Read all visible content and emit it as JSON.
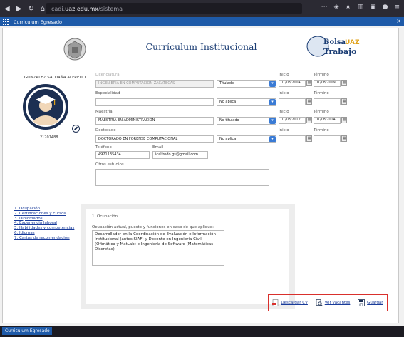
{
  "browser": {
    "url_prefix": "cadi.",
    "url_host": "uaz.edu.mx",
    "url_path": "/sistema"
  },
  "app": {
    "title": "Curriculum Egresado",
    "close": "×",
    "taskbar_tab": "Curriculum Egresado"
  },
  "page": {
    "title": "Currículum Institucional"
  },
  "profile": {
    "name": "GONZALEZ SALDAÑA ALFREDO",
    "code": "21201488"
  },
  "labels": {
    "licenciatura": "Licenciatura",
    "especialidad": "Especialidad",
    "maestria": "Maestría",
    "doctorado": "Doctorado",
    "telefono": "Teléfono",
    "email": "Email",
    "otros": "Otros estudios",
    "inicio": "Inicio",
    "termino": "Término"
  },
  "studies": {
    "licenciatura": {
      "value": "INGENIERIA EN COMPUTACION ZACATECAS",
      "status": "Titulado",
      "inicio": "01/08/2004",
      "termino": "01/08/2009"
    },
    "especialidad": {
      "value": "",
      "status": "No aplica",
      "inicio": "",
      "termino": ""
    },
    "maestria": {
      "value": "MAESTRIA EN ADMINISTRACION",
      "status": "No titulado",
      "inicio": "01/08/2012",
      "termino": "01/08/2014"
    },
    "doctorado": {
      "value": "DOCTORADO EN FORENSE COMPUTACIONAL",
      "status": "No aplica",
      "inicio": "",
      "termino": ""
    }
  },
  "contact": {
    "telefono": "4921135434",
    "email": "icalfredo.gs@gmail.com"
  },
  "menu": [
    "1. Ocupación",
    "2. Certificaciones y cursos",
    "3. Diplomados",
    "4. Experiencia laboral",
    "5. Habilidades y competencias",
    "6. Idiomas",
    "7. Cartas de recomendación"
  ],
  "occupation": {
    "heading": "1. Ocupación",
    "question": "Ocupación actual, puesto y funciones en caso de que aplique:",
    "answer": "Desarrollador en la Coordinación de Evaluación e Información Institucional (antes SIAF) y Docente en Ingeniería Civil (Ofimática y MatLab) e Ingeniería de Software (Matemáticas Discretas)."
  },
  "actions": {
    "download": "Descargar CV",
    "vacancies": "Ver vacantes",
    "save": "Guardar"
  },
  "colors": {
    "accent": "#1e5aa8",
    "title": "#1a3c73",
    "highlight_border": "#d9302c"
  }
}
